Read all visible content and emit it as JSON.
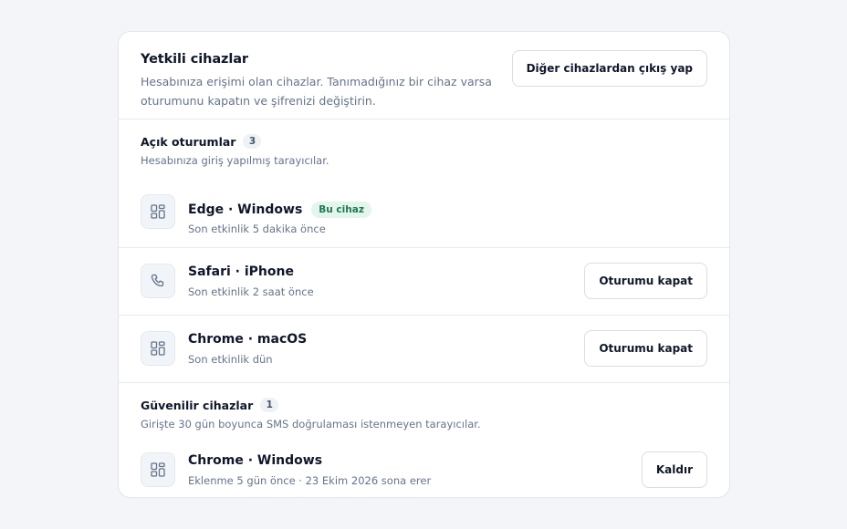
{
  "header": {
    "title": "Yetkili cihazlar",
    "description": "Hesabınıza erişimi olan cihazlar. Tanımadığınız bir cihaz varsa oturumunu kapatın ve şifrenizi değiştirin.",
    "signout_others_label": "Diğer cihazlardan çıkış yap"
  },
  "open_sessions": {
    "title": "Açık oturumlar",
    "count": "3",
    "subtitle": "Hesabınıza giriş yapılmış tarayıcılar.",
    "items": [
      {
        "name": "Edge · Windows",
        "badge": "Bu cihaz",
        "activity": "Son etkinlik 5 dakika önce",
        "icon": "grid-icon"
      },
      {
        "name": "Safari · iPhone",
        "activity": "Son etkinlik 2 saat önce",
        "action": "Oturumu kapat",
        "icon": "phone-icon"
      },
      {
        "name": "Chrome · macOS",
        "activity": "Son etkinlik dün",
        "action": "Oturumu kapat",
        "icon": "grid-icon"
      }
    ]
  },
  "trusted_devices": {
    "title": "Güvenilir cihazlar",
    "count": "1",
    "subtitle": "Girişte 30 gün boyunca SMS doğrulaması istenmeyen tarayıcılar.",
    "items": [
      {
        "name": "Chrome · Windows",
        "activity": "Eklenme 5 gün önce · 23 Ekim 2026 sona erer",
        "action": "Kaldır",
        "icon": "grid-icon"
      }
    ]
  },
  "colors": {
    "accent_badge_bg": "#e3f5ec",
    "accent_badge_text": "#1f7a4d",
    "muted_text": "#64748b"
  }
}
